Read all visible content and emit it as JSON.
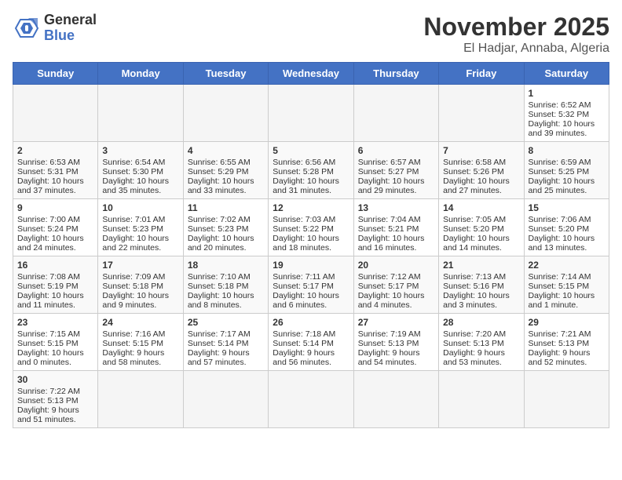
{
  "header": {
    "logo_general": "General",
    "logo_blue": "Blue",
    "month": "November 2025",
    "location": "El Hadjar, Annaba, Algeria"
  },
  "days_of_week": [
    "Sunday",
    "Monday",
    "Tuesday",
    "Wednesday",
    "Thursday",
    "Friday",
    "Saturday"
  ],
  "weeks": [
    [
      {
        "day": "",
        "empty": true
      },
      {
        "day": "",
        "empty": true
      },
      {
        "day": "",
        "empty": true
      },
      {
        "day": "",
        "empty": true
      },
      {
        "day": "",
        "empty": true
      },
      {
        "day": "",
        "empty": true
      },
      {
        "day": "1",
        "sunrise": "6:52 AM",
        "sunset": "5:32 PM",
        "daylight": "10 hours and 39 minutes."
      }
    ],
    [
      {
        "day": "2",
        "sunrise": "6:53 AM",
        "sunset": "5:31 PM",
        "daylight": "10 hours and 37 minutes."
      },
      {
        "day": "3",
        "sunrise": "6:54 AM",
        "sunset": "5:30 PM",
        "daylight": "10 hours and 35 minutes."
      },
      {
        "day": "4",
        "sunrise": "6:55 AM",
        "sunset": "5:29 PM",
        "daylight": "10 hours and 33 minutes."
      },
      {
        "day": "5",
        "sunrise": "6:56 AM",
        "sunset": "5:28 PM",
        "daylight": "10 hours and 31 minutes."
      },
      {
        "day": "6",
        "sunrise": "6:57 AM",
        "sunset": "5:27 PM",
        "daylight": "10 hours and 29 minutes."
      },
      {
        "day": "7",
        "sunrise": "6:58 AM",
        "sunset": "5:26 PM",
        "daylight": "10 hours and 27 minutes."
      },
      {
        "day": "8",
        "sunrise": "6:59 AM",
        "sunset": "5:25 PM",
        "daylight": "10 hours and 25 minutes."
      }
    ],
    [
      {
        "day": "9",
        "sunrise": "7:00 AM",
        "sunset": "5:24 PM",
        "daylight": "10 hours and 24 minutes."
      },
      {
        "day": "10",
        "sunrise": "7:01 AM",
        "sunset": "5:23 PM",
        "daylight": "10 hours and 22 minutes."
      },
      {
        "day": "11",
        "sunrise": "7:02 AM",
        "sunset": "5:23 PM",
        "daylight": "10 hours and 20 minutes."
      },
      {
        "day": "12",
        "sunrise": "7:03 AM",
        "sunset": "5:22 PM",
        "daylight": "10 hours and 18 minutes."
      },
      {
        "day": "13",
        "sunrise": "7:04 AM",
        "sunset": "5:21 PM",
        "daylight": "10 hours and 16 minutes."
      },
      {
        "day": "14",
        "sunrise": "7:05 AM",
        "sunset": "5:20 PM",
        "daylight": "10 hours and 14 minutes."
      },
      {
        "day": "15",
        "sunrise": "7:06 AM",
        "sunset": "5:20 PM",
        "daylight": "10 hours and 13 minutes."
      }
    ],
    [
      {
        "day": "16",
        "sunrise": "7:08 AM",
        "sunset": "5:19 PM",
        "daylight": "10 hours and 11 minutes."
      },
      {
        "day": "17",
        "sunrise": "7:09 AM",
        "sunset": "5:18 PM",
        "daylight": "10 hours and 9 minutes."
      },
      {
        "day": "18",
        "sunrise": "7:10 AM",
        "sunset": "5:18 PM",
        "daylight": "10 hours and 8 minutes."
      },
      {
        "day": "19",
        "sunrise": "7:11 AM",
        "sunset": "5:17 PM",
        "daylight": "10 hours and 6 minutes."
      },
      {
        "day": "20",
        "sunrise": "7:12 AM",
        "sunset": "5:17 PM",
        "daylight": "10 hours and 4 minutes."
      },
      {
        "day": "21",
        "sunrise": "7:13 AM",
        "sunset": "5:16 PM",
        "daylight": "10 hours and 3 minutes."
      },
      {
        "day": "22",
        "sunrise": "7:14 AM",
        "sunset": "5:15 PM",
        "daylight": "10 hours and 1 minute."
      }
    ],
    [
      {
        "day": "23",
        "sunrise": "7:15 AM",
        "sunset": "5:15 PM",
        "daylight": "10 hours and 0 minutes."
      },
      {
        "day": "24",
        "sunrise": "7:16 AM",
        "sunset": "5:15 PM",
        "daylight": "9 hours and 58 minutes."
      },
      {
        "day": "25",
        "sunrise": "7:17 AM",
        "sunset": "5:14 PM",
        "daylight": "9 hours and 57 minutes."
      },
      {
        "day": "26",
        "sunrise": "7:18 AM",
        "sunset": "5:14 PM",
        "daylight": "9 hours and 56 minutes."
      },
      {
        "day": "27",
        "sunrise": "7:19 AM",
        "sunset": "5:13 PM",
        "daylight": "9 hours and 54 minutes."
      },
      {
        "day": "28",
        "sunrise": "7:20 AM",
        "sunset": "5:13 PM",
        "daylight": "9 hours and 53 minutes."
      },
      {
        "day": "29",
        "sunrise": "7:21 AM",
        "sunset": "5:13 PM",
        "daylight": "9 hours and 52 minutes."
      }
    ],
    [
      {
        "day": "30",
        "sunrise": "7:22 AM",
        "sunset": "5:13 PM",
        "daylight": "9 hours and 51 minutes."
      },
      {
        "day": "",
        "empty": true
      },
      {
        "day": "",
        "empty": true
      },
      {
        "day": "",
        "empty": true
      },
      {
        "day": "",
        "empty": true
      },
      {
        "day": "",
        "empty": true
      },
      {
        "day": "",
        "empty": true
      }
    ]
  ]
}
